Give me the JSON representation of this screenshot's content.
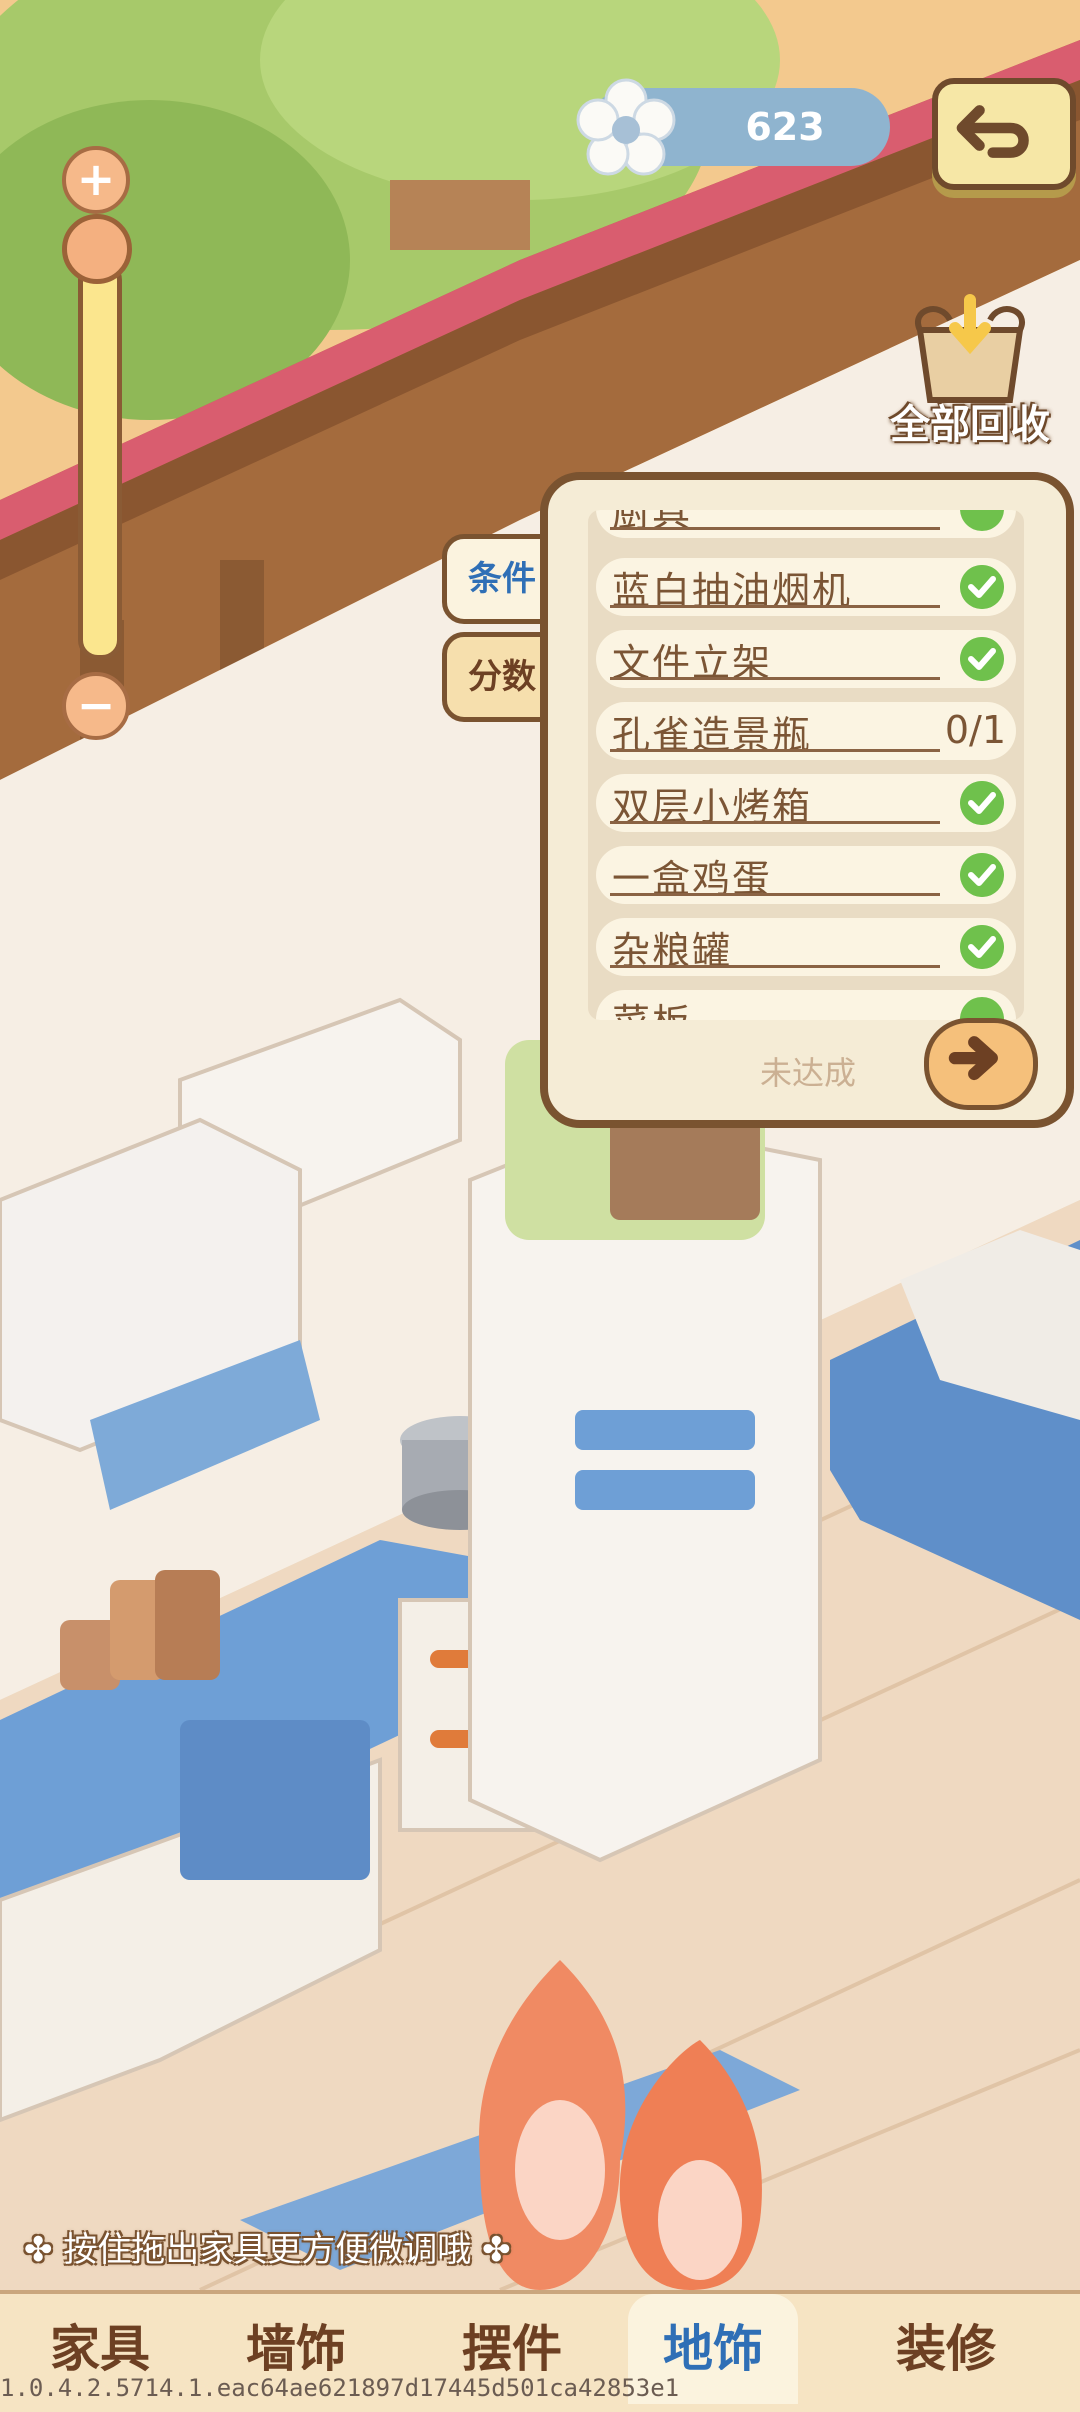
{
  "hud": {
    "currency_value": "623",
    "currency_icon": "flower-icon",
    "back_icon": "undo-arrow-icon",
    "recycle_label": "全部回收",
    "recycle_icon": "recycle-bag-icon"
  },
  "zoom": {
    "plus": "+",
    "minus": "−"
  },
  "side_tabs": [
    {
      "label": "条件",
      "active": true
    },
    {
      "label": "分数",
      "active": false
    }
  ],
  "panel": {
    "partial_top_item": "厨具",
    "items": [
      {
        "name": "蓝白抽油烟机",
        "status": "check"
      },
      {
        "name": "文件立架",
        "status": "check"
      },
      {
        "name": "孔雀造景瓶",
        "status": "0/1"
      },
      {
        "name": "双层小烤箱",
        "status": "check"
      },
      {
        "name": "一盒鸡蛋",
        "status": "check"
      },
      {
        "name": "杂粮罐",
        "status": "check"
      }
    ],
    "partial_bottom_item": "菜板",
    "unmet_label": "未达成",
    "go_icon": "arrow-right-icon"
  },
  "hint": "按住拖出家具更方便微调哦",
  "bottom_tabs": [
    {
      "label": "家具",
      "active": false
    },
    {
      "label": "墙饰",
      "active": false
    },
    {
      "label": "摆件",
      "active": false
    },
    {
      "label": "地饰",
      "active": true
    },
    {
      "label": "装修",
      "active": false
    }
  ],
  "build_info": "1.0.4.2.5714.1.eac64ae621897d17445d501ca42853e1",
  "colors": {
    "accent_blue": "#2f6fb6",
    "brown_outline": "#7a5330",
    "check_green": "#6fc14c"
  }
}
